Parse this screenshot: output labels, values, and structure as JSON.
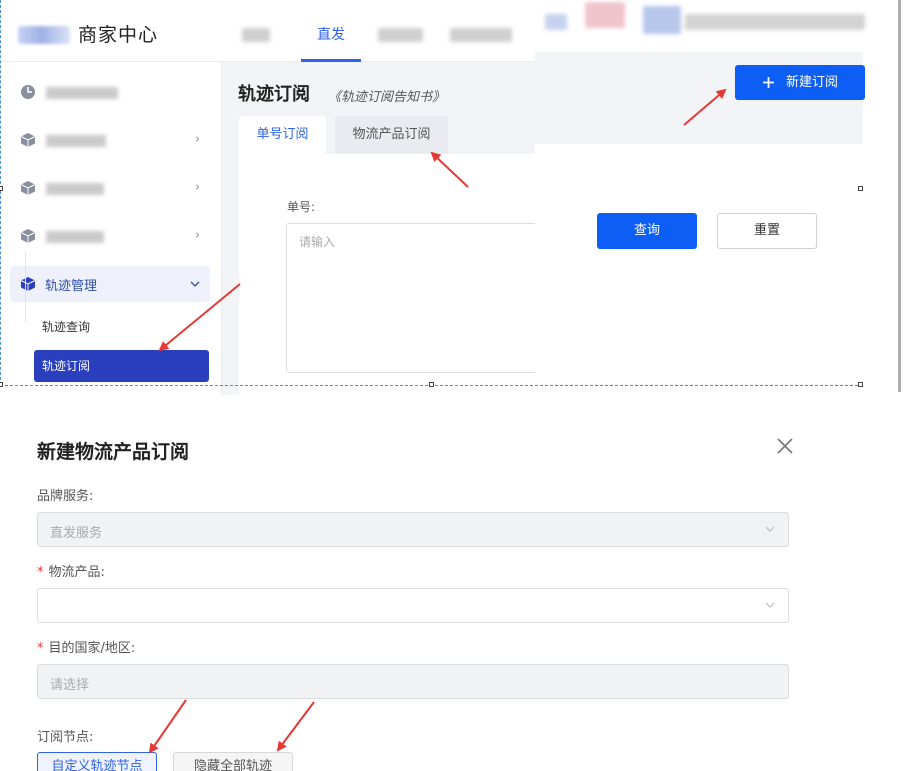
{
  "header": {
    "app_title": "商家中心",
    "nav_active": "直发"
  },
  "sidebar": {
    "active_parent": "轨迹管理",
    "sub_items": [
      "轨迹查询",
      "轨迹订阅"
    ]
  },
  "page": {
    "title": "轨迹订阅",
    "subtitle": "《轨迹订阅告知书》",
    "tabs": [
      "单号订阅",
      "物流产品订阅"
    ],
    "field_label": "单号:",
    "textarea_placeholder": "请输入",
    "new_button": "新建订阅",
    "query_button": "查询",
    "reset_button": "重置"
  },
  "modal": {
    "title": "新建物流产品订阅",
    "fields": [
      {
        "label": "品牌服务:",
        "required": false,
        "value": "直发服务",
        "disabled": true
      },
      {
        "label": "物流产品:",
        "required": true,
        "value": "",
        "disabled": false
      },
      {
        "label": "目的国家/地区:",
        "required": true,
        "value": "请选择",
        "disabled": true
      }
    ],
    "node_label": "订阅节点:",
    "node_buttons": [
      "自定义轨迹节点",
      "隐藏全部轨迹"
    ],
    "required_mark": "*"
  },
  "colors": {
    "primary": "#0d5ef5",
    "sidebar_selected": "#2a3fbd",
    "annotation_arrow": "#e53935",
    "tab_active_text": "#2f62e6"
  },
  "icons": {
    "close": "close-icon",
    "plus": "plus-icon",
    "chevron": "chevron-down-icon",
    "cube": "cube-icon",
    "dashboard": "dashboard-icon"
  }
}
